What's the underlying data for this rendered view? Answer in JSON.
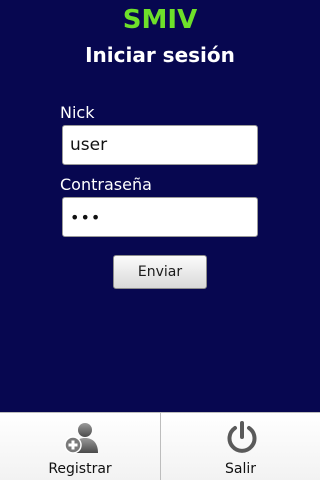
{
  "header": {
    "app_title": "SMIV",
    "screen_title": "Iniciar sesión"
  },
  "form": {
    "nick_label": "Nick",
    "nick_value": "user",
    "password_label": "Contraseña",
    "password_value": "•••",
    "submit_label": "Enviar"
  },
  "bottom_bar": {
    "register": {
      "label": "Registrar",
      "icon": "add-user-icon"
    },
    "exit": {
      "label": "Salir",
      "icon": "power-icon"
    }
  },
  "colors": {
    "background": "#070750",
    "app_title": "#6ee02a"
  }
}
